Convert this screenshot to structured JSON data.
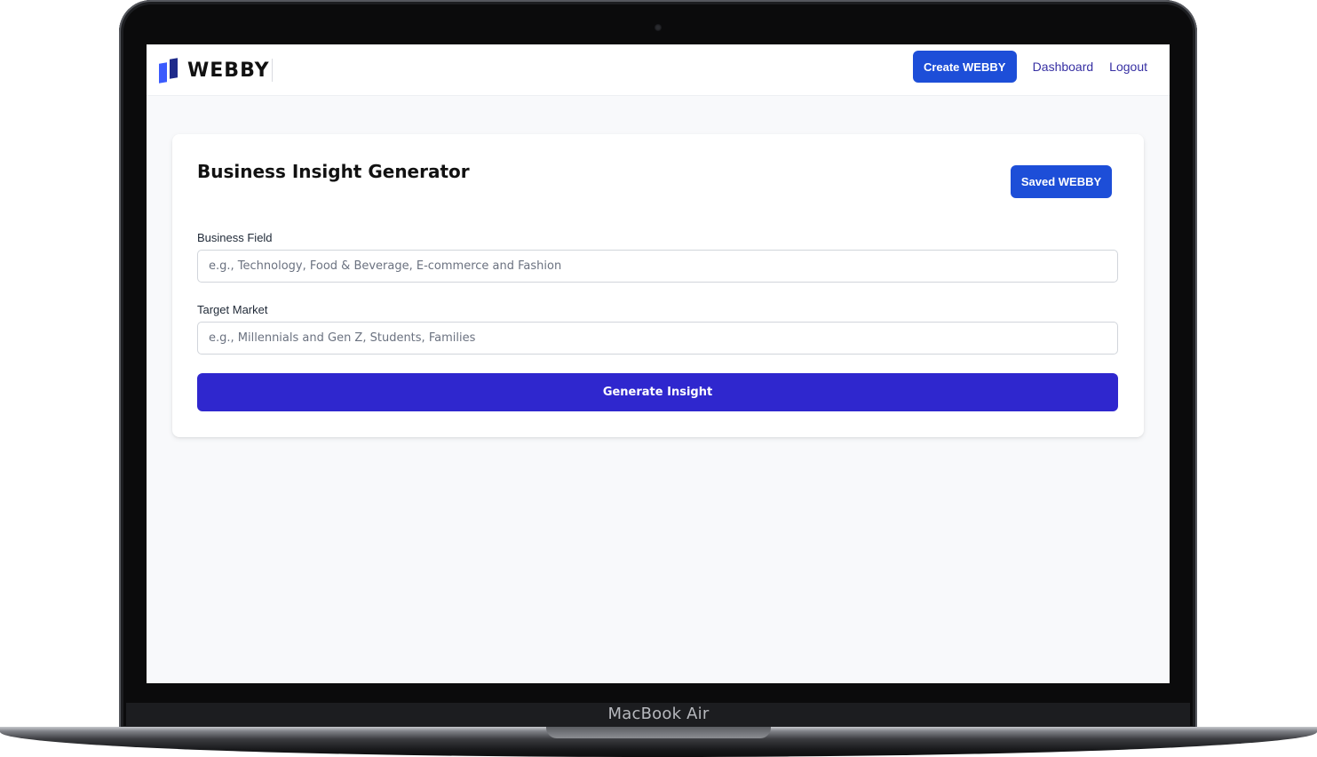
{
  "device": {
    "model_label": "MacBook Air"
  },
  "header": {
    "logo_text": "WEBBY",
    "create_label": "Create WEBBY",
    "nav": {
      "dashboard_label": "Dashboard",
      "logout_label": "Logout"
    }
  },
  "main": {
    "title": "Business Insight Generator",
    "saved_label": "Saved WEBBY",
    "fields": {
      "business_field": {
        "label": "Business Field",
        "value": "",
        "placeholder": "e.g., Technology, Food & Beverage, E-commerce and Fashion"
      },
      "target_market": {
        "label": "Target Market",
        "value": "",
        "placeholder": "e.g., Millennials and Gen Z, Students, Families"
      }
    },
    "generate_label": "Generate Insight"
  },
  "colors": {
    "primary_button": "#1d4ed8",
    "generate_button": "#2f27ce",
    "nav_link": "#3730a3",
    "logo_light": "#3b5bfd",
    "logo_dark": "#1e2a8a"
  }
}
